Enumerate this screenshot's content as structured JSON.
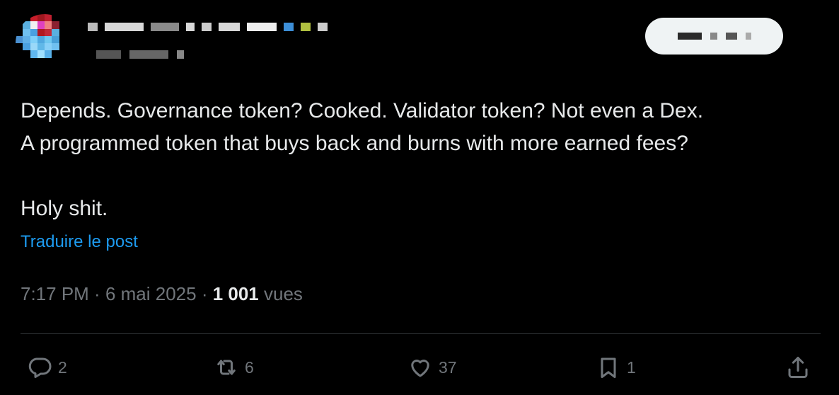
{
  "post": {
    "text": "Depends. Governance token? Cooked. Validator token? Not even a Dex.\nA programmed token that buys back and burns with more earned fees?\n\nHoly shit.",
    "translate_label": "Traduire le post",
    "time": "7:17 PM",
    "date": "6 mai 2025",
    "views_count": "1 001",
    "views_label": "vues",
    "separator": " · "
  },
  "actions": {
    "replies": "2",
    "reposts": "6",
    "likes": "37",
    "bookmarks": "1"
  },
  "icons": {
    "reply": "reply-icon",
    "repost": "repost-icon",
    "like": "heart-icon",
    "bookmark": "bookmark-icon",
    "share": "share-icon"
  },
  "colors": {
    "background": "#000000",
    "text": "#e7e9ea",
    "muted": "#71767b",
    "link": "#1d9bf0",
    "divider": "#2f3336"
  }
}
